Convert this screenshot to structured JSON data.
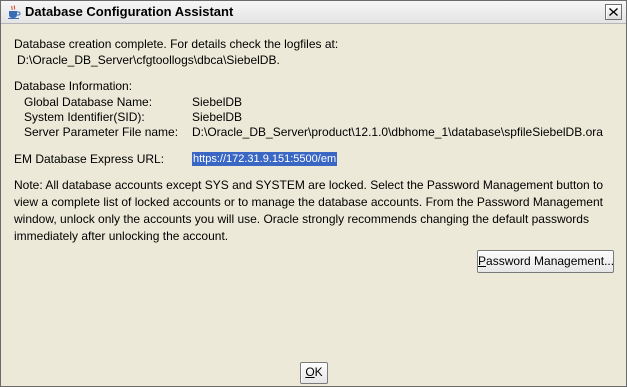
{
  "window": {
    "title": "Database Configuration Assistant",
    "title_icon": "java-coffee-cup-icon",
    "close_icon": "close-icon"
  },
  "messages": {
    "completion_line": "Database creation complete. For details check the logfiles at:",
    "log_path": "D:\\Oracle_DB_Server\\cfgtoollogs\\dbca\\SiebelDB.",
    "info_heading": "Database Information:"
  },
  "database_info": [
    {
      "label": "Global Database Name:",
      "value": "SiebelDB"
    },
    {
      "label": "System Identifier(SID):",
      "value": "SiebelDB"
    },
    {
      "label": "Server Parameter File name:",
      "value": "D:\\Oracle_DB_Server\\product\\12.1.0\\dbhome_1\\database\\spfileSiebelDB.ora"
    }
  ],
  "em_express": {
    "label": "EM Database Express URL:",
    "url": "https://172.31.9.151:5500/em",
    "highlight_color": "#3a66c4"
  },
  "note": "Note: All database accounts except SYS and SYSTEM are locked. Select the Password Management button to view a complete list of locked accounts or to manage the database accounts. From the Password Management window, unlock only the accounts you will use. Oracle strongly recommends changing the default passwords immediately after unlocking the account.",
  "buttons": {
    "password_management_pre": "",
    "password_management_mnemonic": "P",
    "password_management_post": "assword Management...",
    "ok_mnemonic": "O",
    "ok_post": "K"
  },
  "colors": {
    "background": "#ece9d8",
    "selection": "#3a66c4"
  }
}
